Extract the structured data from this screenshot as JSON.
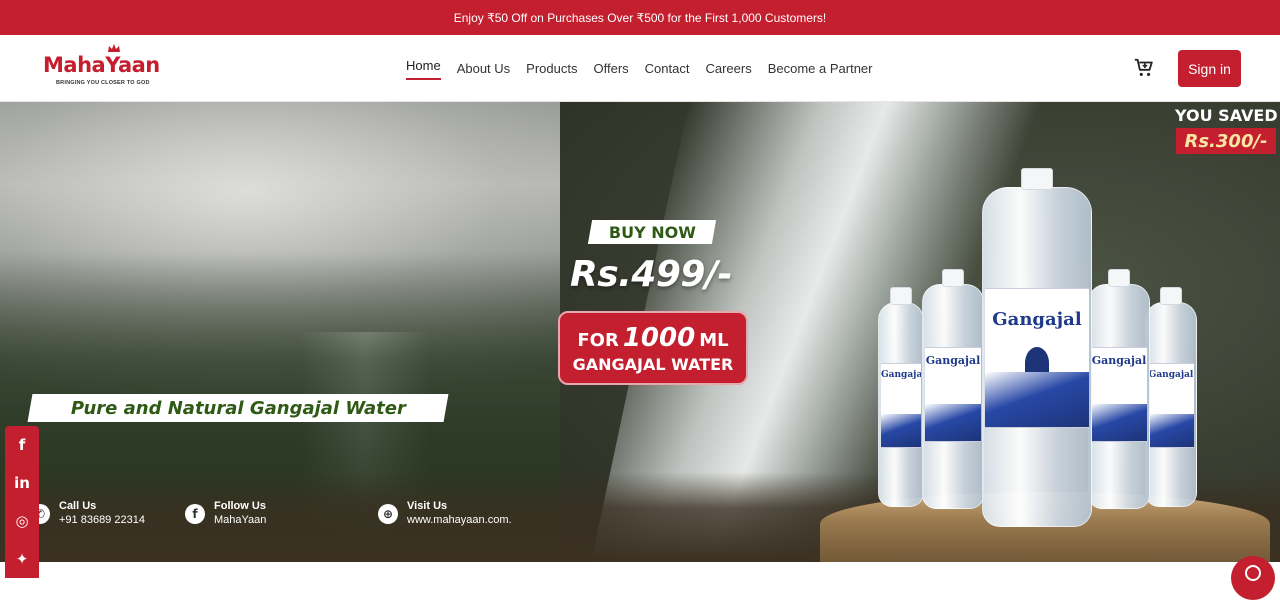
{
  "promo": {
    "text": "Enjoy ₹50 Off on Purchases Over ₹500 for the First 1,000 Customers!"
  },
  "brand": {
    "name": "MahaYaan",
    "tagline": "BRINGING YOU CLOSER TO GOD"
  },
  "nav": {
    "items": [
      "Home",
      "About Us",
      "Products",
      "Offers",
      "Contact",
      "Careers",
      "Become a Partner"
    ],
    "active": "Home"
  },
  "header": {
    "cart_icon": "cart-icon",
    "signin_label": "Sign in"
  },
  "hero": {
    "saved_title": "YOU SAVED",
    "saved_amount": "Rs.300/-",
    "buy_now": "BUY NOW",
    "price": "Rs.499/-",
    "qty_prefix": "FOR",
    "qty_value": "1000",
    "qty_unit": "ML",
    "product_name": "GANGAJAL WATER",
    "tagline": "Pure and Natural Gangajal Water",
    "bottle_brand": "Gangajal"
  },
  "contacts": [
    {
      "icon": "phone-icon",
      "title": "Call Us",
      "value": "+91 83689 22314"
    },
    {
      "icon": "facebook-icon",
      "title": "Follow Us",
      "value": "MahaYaan"
    },
    {
      "icon": "globe-icon",
      "title": "Visit Us",
      "value": "www.mahayaan.com."
    }
  ],
  "social": [
    "facebook-icon",
    "linkedin-icon",
    "instagram-icon",
    "twitter-icon"
  ],
  "colors": {
    "brand_red": "#c41f2f",
    "hero_green": "#2f5a16",
    "saved_gold": "#f7e5a3"
  }
}
